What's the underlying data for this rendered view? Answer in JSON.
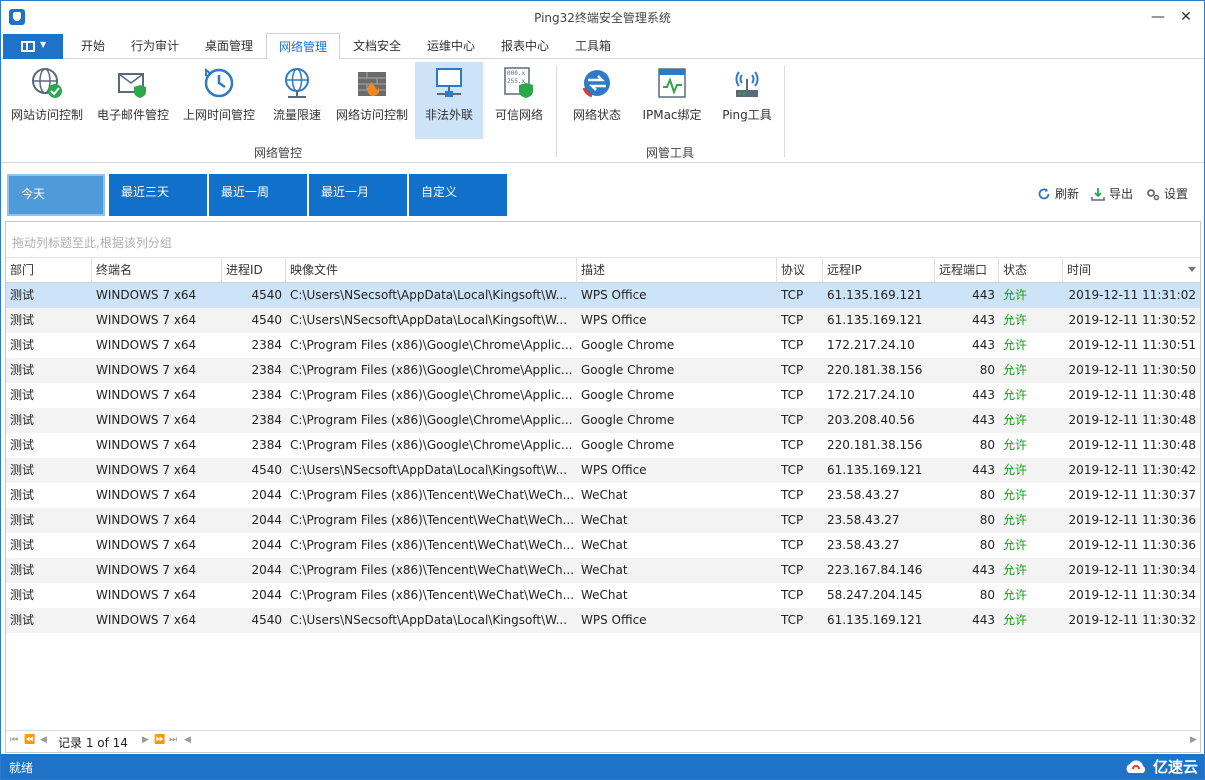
{
  "window": {
    "title": "Ping32终端安全管理系统"
  },
  "tabs": [
    {
      "label": "开始"
    },
    {
      "label": "行为审计"
    },
    {
      "label": "桌面管理"
    },
    {
      "label": "网络管理"
    },
    {
      "label": "文档安全"
    },
    {
      "label": "运维中心"
    },
    {
      "label": "报表中心"
    },
    {
      "label": "工具箱"
    }
  ],
  "ribbon": {
    "buttons": [
      {
        "label": "网站访问控制",
        "icon": "globe-check-icon"
      },
      {
        "label": "电子邮件管控",
        "icon": "email-shield-icon"
      },
      {
        "label": "上网时间管控",
        "icon": "clock-history-icon"
      },
      {
        "label": "流量限速",
        "icon": "globe-network-icon"
      },
      {
        "label": "网络访问控制",
        "icon": "firewall-icon"
      },
      {
        "label": "非法外联",
        "icon": "monitor-network-icon"
      },
      {
        "label": "可信网络",
        "icon": "ip-shield-icon"
      },
      {
        "label": "网络状态",
        "icon": "network-status-icon"
      },
      {
        "label": "IPMac绑定",
        "icon": "ipmac-icon"
      },
      {
        "label": "Ping工具",
        "icon": "ping-antenna-icon"
      }
    ],
    "groups": [
      "网络管控",
      "网管工具"
    ]
  },
  "ranges": [
    "今天",
    "最近三天",
    "最近一周",
    "最近一月",
    "自定义"
  ],
  "actions": {
    "refresh": "刷新",
    "export": "导出",
    "settings": "设置"
  },
  "grid": {
    "group_hint": "拖动列标题至此,根据该列分组",
    "columns": [
      "部门",
      "终端名",
      "进程ID",
      "映像文件",
      "描述",
      "协议",
      "远程IP",
      "远程端口",
      "状态",
      "时间"
    ],
    "rows": [
      [
        "测试",
        "WINDOWS 7 x64",
        "4540",
        "C:\\Users\\NSecsoft\\AppData\\Local\\Kingsoft\\W...",
        "WPS Office",
        "TCP",
        "61.135.169.121",
        "443",
        "允许",
        "2019-12-11 11:31:02"
      ],
      [
        "测试",
        "WINDOWS 7 x64",
        "4540",
        "C:\\Users\\NSecsoft\\AppData\\Local\\Kingsoft\\W...",
        "WPS Office",
        "TCP",
        "61.135.169.121",
        "443",
        "允许",
        "2019-12-11 11:30:52"
      ],
      [
        "测试",
        "WINDOWS 7 x64",
        "2384",
        "C:\\Program Files (x86)\\Google\\Chrome\\Applic...",
        "Google Chrome",
        "TCP",
        "172.217.24.10",
        "443",
        "允许",
        "2019-12-11 11:30:51"
      ],
      [
        "测试",
        "WINDOWS 7 x64",
        "2384",
        "C:\\Program Files (x86)\\Google\\Chrome\\Applic...",
        "Google Chrome",
        "TCP",
        "220.181.38.156",
        "80",
        "允许",
        "2019-12-11 11:30:50"
      ],
      [
        "测试",
        "WINDOWS 7 x64",
        "2384",
        "C:\\Program Files (x86)\\Google\\Chrome\\Applic...",
        "Google Chrome",
        "TCP",
        "172.217.24.10",
        "443",
        "允许",
        "2019-12-11 11:30:48"
      ],
      [
        "测试",
        "WINDOWS 7 x64",
        "2384",
        "C:\\Program Files (x86)\\Google\\Chrome\\Applic...",
        "Google Chrome",
        "TCP",
        "203.208.40.56",
        "443",
        "允许",
        "2019-12-11 11:30:48"
      ],
      [
        "测试",
        "WINDOWS 7 x64",
        "2384",
        "C:\\Program Files (x86)\\Google\\Chrome\\Applic...",
        "Google Chrome",
        "TCP",
        "220.181.38.156",
        "80",
        "允许",
        "2019-12-11 11:30:48"
      ],
      [
        "测试",
        "WINDOWS 7 x64",
        "4540",
        "C:\\Users\\NSecsoft\\AppData\\Local\\Kingsoft\\W...",
        "WPS Office",
        "TCP",
        "61.135.169.121",
        "443",
        "允许",
        "2019-12-11 11:30:42"
      ],
      [
        "测试",
        "WINDOWS 7 x64",
        "2044",
        "C:\\Program Files (x86)\\Tencent\\WeChat\\WeCh...",
        "WeChat",
        "TCP",
        "23.58.43.27",
        "80",
        "允许",
        "2019-12-11 11:30:37"
      ],
      [
        "测试",
        "WINDOWS 7 x64",
        "2044",
        "C:\\Program Files (x86)\\Tencent\\WeChat\\WeCh...",
        "WeChat",
        "TCP",
        "23.58.43.27",
        "80",
        "允许",
        "2019-12-11 11:30:36"
      ],
      [
        "测试",
        "WINDOWS 7 x64",
        "2044",
        "C:\\Program Files (x86)\\Tencent\\WeChat\\WeCh...",
        "WeChat",
        "TCP",
        "23.58.43.27",
        "80",
        "允许",
        "2019-12-11 11:30:36"
      ],
      [
        "测试",
        "WINDOWS 7 x64",
        "2044",
        "C:\\Program Files (x86)\\Tencent\\WeChat\\WeCh...",
        "WeChat",
        "TCP",
        "223.167.84.146",
        "443",
        "允许",
        "2019-12-11 11:30:34"
      ],
      [
        "测试",
        "WINDOWS 7 x64",
        "2044",
        "C:\\Program Files (x86)\\Tencent\\WeChat\\WeCh...",
        "WeChat",
        "TCP",
        "58.247.204.145",
        "80",
        "允许",
        "2019-12-11 11:30:34"
      ],
      [
        "测试",
        "WINDOWS 7 x64",
        "4540",
        "C:\\Users\\NSecsoft\\AppData\\Local\\Kingsoft\\W...",
        "WPS Office",
        "TCP",
        "61.135.169.121",
        "443",
        "允许",
        "2019-12-11 11:30:32"
      ]
    ],
    "pager": {
      "record_text": "记录 1 of 14"
    }
  },
  "status": {
    "text": "就绪"
  },
  "watermark": {
    "text": "亿速云"
  },
  "colors": {
    "accent": "#1e73c8",
    "allowed": "#1a9b1a",
    "selected_row": "#cde3f7"
  }
}
